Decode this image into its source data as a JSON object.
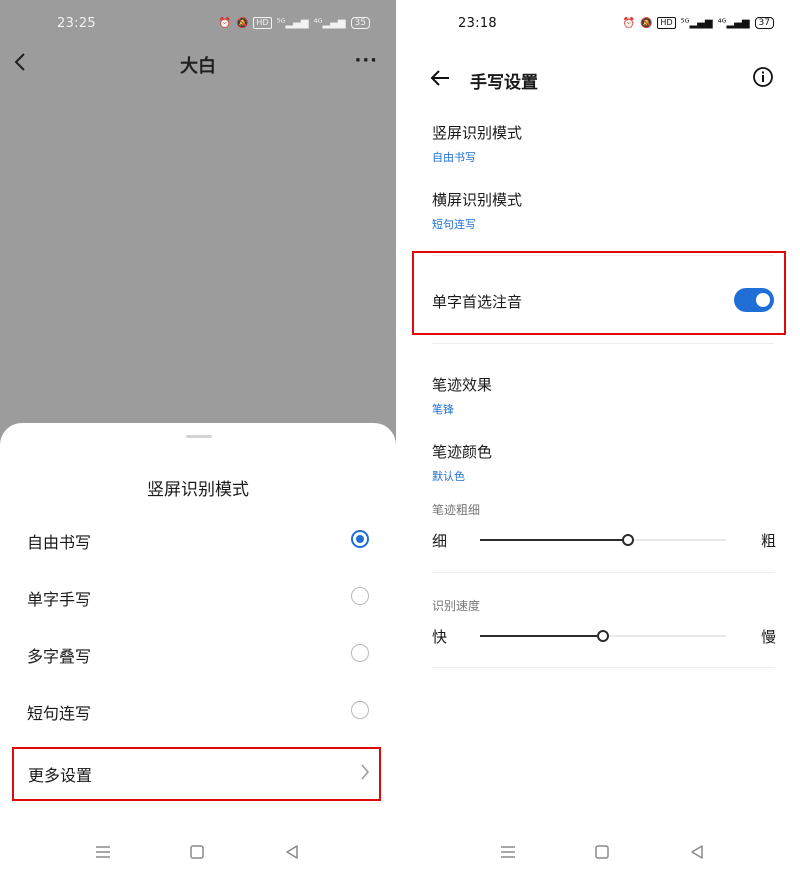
{
  "left_screen": {
    "status": {
      "time": "23:25",
      "battery": "35"
    },
    "header": {
      "title": "大白"
    },
    "sheet": {
      "title": "竖屏识别模式",
      "options": [
        {
          "label": "自由书写",
          "selected": true
        },
        {
          "label": "单字手写",
          "selected": false
        },
        {
          "label": "多字叠写",
          "selected": false
        },
        {
          "label": "短句连写",
          "selected": false
        }
      ],
      "more_settings": "更多设置"
    }
  },
  "right_screen": {
    "status": {
      "time": "23:18",
      "battery": "37"
    },
    "header": {
      "title": "手写设置"
    },
    "portrait_mode": {
      "label": "竖屏识别模式",
      "value": "自由书写"
    },
    "landscape_mode": {
      "label": "横屏识别模式",
      "value": "短句连写"
    },
    "pinyin_toggle": {
      "label": "单字首选注音",
      "on": true
    },
    "stroke_effect": {
      "label": "笔迹效果",
      "value": "笔锋"
    },
    "stroke_color": {
      "label": "笔迹颜色",
      "value": "默认色"
    },
    "stroke_width": {
      "caption": "笔迹粗细",
      "min_label": "细",
      "max_label": "粗",
      "level": 0.6
    },
    "recognition_speed": {
      "caption": "识别速度",
      "min_label": "快",
      "max_label": "慢",
      "level": 0.5
    }
  },
  "colors": {
    "accent": "#1f6fd6",
    "highlight": "#e10a0a",
    "dim_bg": "#9c9c9c"
  }
}
